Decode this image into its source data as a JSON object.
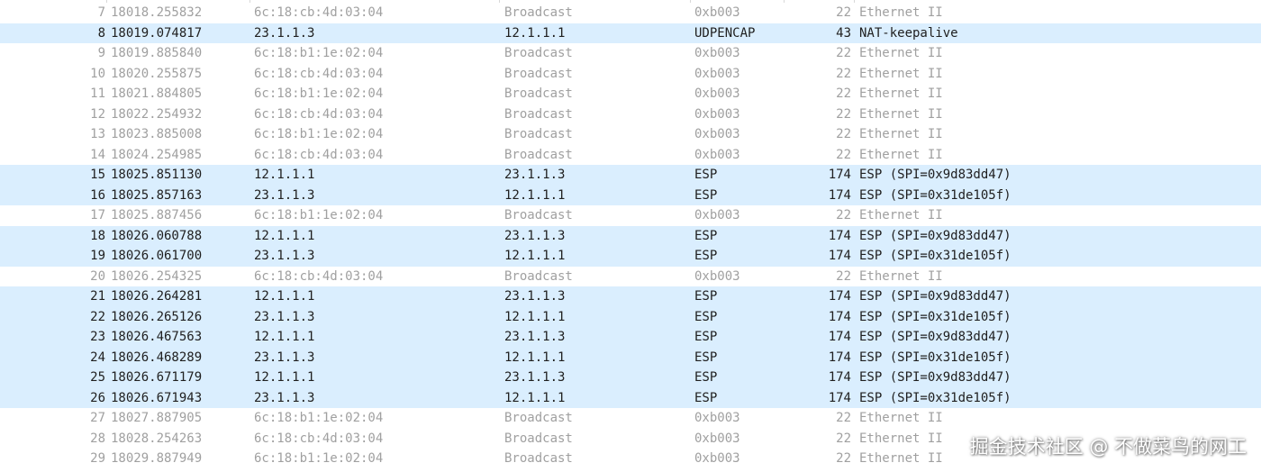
{
  "colors": {
    "row_highlight": "#daeefe",
    "row_normal": "#ffffff",
    "text_dim": "#a0a0a0",
    "text_normal": "#202020"
  },
  "packets": [
    {
      "no": "7",
      "time": "18018.255832",
      "source": "6c:18:cb:4d:03:04",
      "destination": "Broadcast",
      "protocol": "0xb003",
      "length": "22",
      "info": "Ethernet II",
      "style": "grey"
    },
    {
      "no": "8",
      "time": "18019.074817",
      "source": "23.1.1.3",
      "destination": "12.1.1.1",
      "protocol": "UDPENCAP",
      "length": "43",
      "info": "NAT-keepalive",
      "style": "udp"
    },
    {
      "no": "9",
      "time": "18019.885840",
      "source": "6c:18:b1:1e:02:04",
      "destination": "Broadcast",
      "protocol": "0xb003",
      "length": "22",
      "info": "Ethernet II",
      "style": "grey"
    },
    {
      "no": "10",
      "time": "18020.255875",
      "source": "6c:18:cb:4d:03:04",
      "destination": "Broadcast",
      "protocol": "0xb003",
      "length": "22",
      "info": "Ethernet II",
      "style": "grey"
    },
    {
      "no": "11",
      "time": "18021.884805",
      "source": "6c:18:b1:1e:02:04",
      "destination": "Broadcast",
      "protocol": "0xb003",
      "length": "22",
      "info": "Ethernet II",
      "style": "grey"
    },
    {
      "no": "12",
      "time": "18022.254932",
      "source": "6c:18:cb:4d:03:04",
      "destination": "Broadcast",
      "protocol": "0xb003",
      "length": "22",
      "info": "Ethernet II",
      "style": "grey"
    },
    {
      "no": "13",
      "time": "18023.885008",
      "source": "6c:18:b1:1e:02:04",
      "destination": "Broadcast",
      "protocol": "0xb003",
      "length": "22",
      "info": "Ethernet II",
      "style": "grey"
    },
    {
      "no": "14",
      "time": "18024.254985",
      "source": "6c:18:cb:4d:03:04",
      "destination": "Broadcast",
      "protocol": "0xb003",
      "length": "22",
      "info": "Ethernet II",
      "style": "grey"
    },
    {
      "no": "15",
      "time": "18025.851130",
      "source": "12.1.1.1",
      "destination": "23.1.1.3",
      "protocol": "ESP",
      "length": "174",
      "info": "ESP (SPI=0x9d83dd47)",
      "style": "blue"
    },
    {
      "no": "16",
      "time": "18025.857163",
      "source": "23.1.1.3",
      "destination": "12.1.1.1",
      "protocol": "ESP",
      "length": "174",
      "info": "ESP (SPI=0x31de105f)",
      "style": "blue"
    },
    {
      "no": "17",
      "time": "18025.887456",
      "source": "6c:18:b1:1e:02:04",
      "destination": "Broadcast",
      "protocol": "0xb003",
      "length": "22",
      "info": "Ethernet II",
      "style": "grey"
    },
    {
      "no": "18",
      "time": "18026.060788",
      "source": "12.1.1.1",
      "destination": "23.1.1.3",
      "protocol": "ESP",
      "length": "174",
      "info": "ESP (SPI=0x9d83dd47)",
      "style": "blue"
    },
    {
      "no": "19",
      "time": "18026.061700",
      "source": "23.1.1.3",
      "destination": "12.1.1.1",
      "protocol": "ESP",
      "length": "174",
      "info": "ESP (SPI=0x31de105f)",
      "style": "blue"
    },
    {
      "no": "20",
      "time": "18026.254325",
      "source": "6c:18:cb:4d:03:04",
      "destination": "Broadcast",
      "protocol": "0xb003",
      "length": "22",
      "info": "Ethernet II",
      "style": "grey"
    },
    {
      "no": "21",
      "time": "18026.264281",
      "source": "12.1.1.1",
      "destination": "23.1.1.3",
      "protocol": "ESP",
      "length": "174",
      "info": "ESP (SPI=0x9d83dd47)",
      "style": "blue"
    },
    {
      "no": "22",
      "time": "18026.265126",
      "source": "23.1.1.3",
      "destination": "12.1.1.1",
      "protocol": "ESP",
      "length": "174",
      "info": "ESP (SPI=0x31de105f)",
      "style": "blue"
    },
    {
      "no": "23",
      "time": "18026.467563",
      "source": "12.1.1.1",
      "destination": "23.1.1.3",
      "protocol": "ESP",
      "length": "174",
      "info": "ESP (SPI=0x9d83dd47)",
      "style": "blue"
    },
    {
      "no": "24",
      "time": "18026.468289",
      "source": "23.1.1.3",
      "destination": "12.1.1.1",
      "protocol": "ESP",
      "length": "174",
      "info": "ESP (SPI=0x31de105f)",
      "style": "blue"
    },
    {
      "no": "25",
      "time": "18026.671179",
      "source": "12.1.1.1",
      "destination": "23.1.1.3",
      "protocol": "ESP",
      "length": "174",
      "info": "ESP (SPI=0x9d83dd47)",
      "style": "blue"
    },
    {
      "no": "26",
      "time": "18026.671943",
      "source": "23.1.1.3",
      "destination": "12.1.1.1",
      "protocol": "ESP",
      "length": "174",
      "info": "ESP (SPI=0x31de105f)",
      "style": "blue"
    },
    {
      "no": "27",
      "time": "18027.887905",
      "source": "6c:18:b1:1e:02:04",
      "destination": "Broadcast",
      "protocol": "0xb003",
      "length": "22",
      "info": "Ethernet II",
      "style": "grey"
    },
    {
      "no": "28",
      "time": "18028.254263",
      "source": "6c:18:cb:4d:03:04",
      "destination": "Broadcast",
      "protocol": "0xb003",
      "length": "22",
      "info": "Ethernet II",
      "style": "grey"
    },
    {
      "no": "29",
      "time": "18029.887949",
      "source": "6c:18:b1:1e:02:04",
      "destination": "Broadcast",
      "protocol": "0xb003",
      "length": "22",
      "info": "Ethernet II",
      "style": "grey"
    }
  ],
  "watermark": "掘金技术社区 @ 不做菜鸟的网工"
}
